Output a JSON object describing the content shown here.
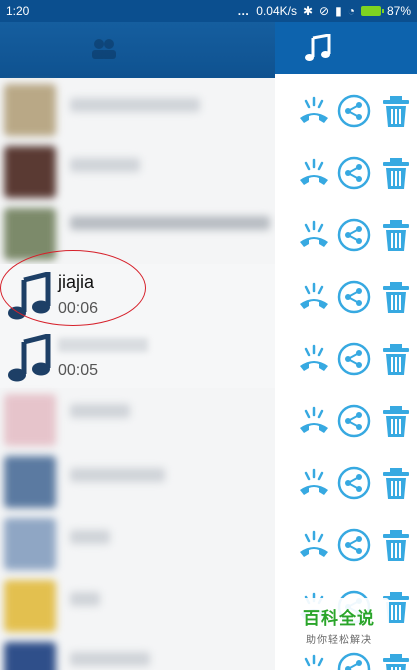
{
  "status_bar": {
    "time": "1:20",
    "network_speed": "0.04K/s",
    "battery_percent": "87%"
  },
  "header": {
    "left_tab_icon": "contacts-icon",
    "right_tab_icon": "music-note-icon"
  },
  "list": {
    "items": [
      {
        "name": "jiajia",
        "duration": "00:06",
        "icon": "music-note-icon"
      },
      {
        "name": "",
        "duration": "00:05",
        "icon": "music-note-icon"
      }
    ]
  },
  "actions": {
    "icons": [
      "call-icon",
      "share-icon",
      "trash-icon"
    ]
  },
  "watermark": {
    "title": "百科全说",
    "subtitle": "助你轻松解决"
  },
  "colors": {
    "header_blue": "#0d5b9d",
    "action_blue": "#37a9e1",
    "highlight_red": "#d6202a",
    "watermark_green": "#2aa52a"
  }
}
